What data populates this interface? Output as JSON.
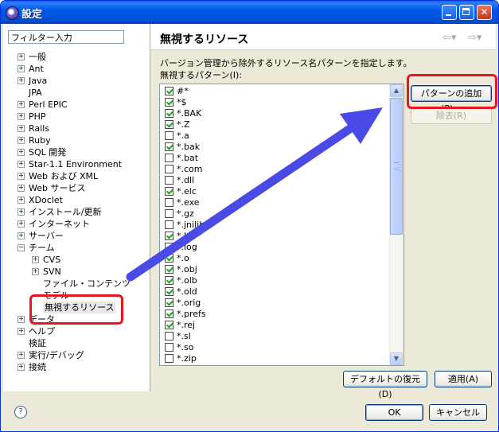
{
  "window": {
    "title": "設定"
  },
  "filter": {
    "value": "フィルター入力"
  },
  "tree": [
    {
      "label": "一般",
      "depth": 0,
      "exp": "+"
    },
    {
      "label": "Ant",
      "depth": 0,
      "exp": "+"
    },
    {
      "label": "Java",
      "depth": 0,
      "exp": "+"
    },
    {
      "label": "JPA",
      "depth": 0,
      "exp": ""
    },
    {
      "label": "Perl EPIC",
      "depth": 0,
      "exp": "+"
    },
    {
      "label": "PHP",
      "depth": 0,
      "exp": "+"
    },
    {
      "label": "Rails",
      "depth": 0,
      "exp": "+"
    },
    {
      "label": "Ruby",
      "depth": 0,
      "exp": "+"
    },
    {
      "label": "SQL 開発",
      "depth": 0,
      "exp": "+"
    },
    {
      "label": "Star-1.1 Environment",
      "depth": 0,
      "exp": "+"
    },
    {
      "label": "Web および XML",
      "depth": 0,
      "exp": "+"
    },
    {
      "label": "Web サービス",
      "depth": 0,
      "exp": "+"
    },
    {
      "label": "XDoclet",
      "depth": 0,
      "exp": "+"
    },
    {
      "label": "インストール/更新",
      "depth": 0,
      "exp": "+"
    },
    {
      "label": "インターネット",
      "depth": 0,
      "exp": "+"
    },
    {
      "label": "サーバー",
      "depth": 0,
      "exp": "+"
    },
    {
      "label": "チーム",
      "depth": 0,
      "exp": "−"
    },
    {
      "label": "CVS",
      "depth": 1,
      "exp": "+"
    },
    {
      "label": "SVN",
      "depth": 1,
      "exp": "+"
    },
    {
      "label": "ファイル・コンテンツ",
      "depth": 1,
      "exp": ""
    },
    {
      "label": "モデル",
      "depth": 1,
      "exp": ""
    },
    {
      "label": "無視するリソース",
      "depth": 1,
      "exp": "",
      "selected": true
    },
    {
      "label": "データ",
      "depth": 0,
      "exp": "+"
    },
    {
      "label": "ヘルプ",
      "depth": 0,
      "exp": "+"
    },
    {
      "label": "検証",
      "depth": 0,
      "exp": ""
    },
    {
      "label": "実行/デバッグ",
      "depth": 0,
      "exp": "+"
    },
    {
      "label": "接続",
      "depth": 0,
      "exp": "+"
    }
  ],
  "page": {
    "title": "無視するリソース",
    "description": "バージョン管理から除外するリソース名パターンを指定します。",
    "list_label": "無視するパターン(I):"
  },
  "patterns": [
    {
      "label": "#*",
      "checked": true
    },
    {
      "label": "*$",
      "checked": true
    },
    {
      "label": "*.BAK",
      "checked": true
    },
    {
      "label": "*.Z",
      "checked": true
    },
    {
      "label": "*.a",
      "checked": false
    },
    {
      "label": "*.bak",
      "checked": true
    },
    {
      "label": "*.bat",
      "checked": false
    },
    {
      "label": "*.com",
      "checked": false
    },
    {
      "label": "*.dll",
      "checked": false
    },
    {
      "label": "*.elc",
      "checked": true
    },
    {
      "label": "*.exe",
      "checked": false
    },
    {
      "label": "*.gz",
      "checked": false
    },
    {
      "label": "*.jnilib",
      "checked": false
    },
    {
      "label": "*.ln",
      "checked": true
    },
    {
      "label": "*.log",
      "checked": true
    },
    {
      "label": "*.o",
      "checked": true
    },
    {
      "label": "*.obj",
      "checked": true
    },
    {
      "label": "*.olb",
      "checked": true
    },
    {
      "label": "*.old",
      "checked": true
    },
    {
      "label": "*.orig",
      "checked": true
    },
    {
      "label": "*.prefs",
      "checked": true
    },
    {
      "label": "*.rej",
      "checked": true
    },
    {
      "label": "*.sl",
      "checked": false
    },
    {
      "label": "*.so",
      "checked": false
    },
    {
      "label": "*.zip",
      "checked": false
    }
  ],
  "buttons": {
    "add_pattern": "パターンの追加(P)...",
    "remove": "除去(R)",
    "restore_defaults": "デフォルトの復元(D)",
    "apply": "適用(A)",
    "ok": "OK",
    "cancel": "キャンセル"
  },
  "colors": {
    "highlight": "#e8161e",
    "arrow": "#4a4ae6",
    "titlebar": "#0058e6"
  }
}
